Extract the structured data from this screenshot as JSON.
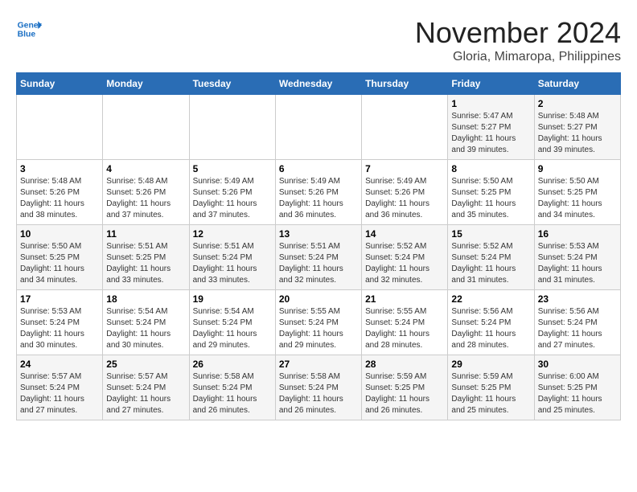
{
  "logo": {
    "line1": "General",
    "line2": "Blue"
  },
  "title": "November 2024",
  "location": "Gloria, Mimaropa, Philippines",
  "days_of_week": [
    "Sunday",
    "Monday",
    "Tuesday",
    "Wednesday",
    "Thursday",
    "Friday",
    "Saturday"
  ],
  "weeks": [
    [
      {
        "day": "",
        "info": ""
      },
      {
        "day": "",
        "info": ""
      },
      {
        "day": "",
        "info": ""
      },
      {
        "day": "",
        "info": ""
      },
      {
        "day": "",
        "info": ""
      },
      {
        "day": "1",
        "info": "Sunrise: 5:47 AM\nSunset: 5:27 PM\nDaylight: 11 hours and 39 minutes."
      },
      {
        "day": "2",
        "info": "Sunrise: 5:48 AM\nSunset: 5:27 PM\nDaylight: 11 hours and 39 minutes."
      }
    ],
    [
      {
        "day": "3",
        "info": "Sunrise: 5:48 AM\nSunset: 5:26 PM\nDaylight: 11 hours and 38 minutes."
      },
      {
        "day": "4",
        "info": "Sunrise: 5:48 AM\nSunset: 5:26 PM\nDaylight: 11 hours and 37 minutes."
      },
      {
        "day": "5",
        "info": "Sunrise: 5:49 AM\nSunset: 5:26 PM\nDaylight: 11 hours and 37 minutes."
      },
      {
        "day": "6",
        "info": "Sunrise: 5:49 AM\nSunset: 5:26 PM\nDaylight: 11 hours and 36 minutes."
      },
      {
        "day": "7",
        "info": "Sunrise: 5:49 AM\nSunset: 5:26 PM\nDaylight: 11 hours and 36 minutes."
      },
      {
        "day": "8",
        "info": "Sunrise: 5:50 AM\nSunset: 5:25 PM\nDaylight: 11 hours and 35 minutes."
      },
      {
        "day": "9",
        "info": "Sunrise: 5:50 AM\nSunset: 5:25 PM\nDaylight: 11 hours and 34 minutes."
      }
    ],
    [
      {
        "day": "10",
        "info": "Sunrise: 5:50 AM\nSunset: 5:25 PM\nDaylight: 11 hours and 34 minutes."
      },
      {
        "day": "11",
        "info": "Sunrise: 5:51 AM\nSunset: 5:25 PM\nDaylight: 11 hours and 33 minutes."
      },
      {
        "day": "12",
        "info": "Sunrise: 5:51 AM\nSunset: 5:24 PM\nDaylight: 11 hours and 33 minutes."
      },
      {
        "day": "13",
        "info": "Sunrise: 5:51 AM\nSunset: 5:24 PM\nDaylight: 11 hours and 32 minutes."
      },
      {
        "day": "14",
        "info": "Sunrise: 5:52 AM\nSunset: 5:24 PM\nDaylight: 11 hours and 32 minutes."
      },
      {
        "day": "15",
        "info": "Sunrise: 5:52 AM\nSunset: 5:24 PM\nDaylight: 11 hours and 31 minutes."
      },
      {
        "day": "16",
        "info": "Sunrise: 5:53 AM\nSunset: 5:24 PM\nDaylight: 11 hours and 31 minutes."
      }
    ],
    [
      {
        "day": "17",
        "info": "Sunrise: 5:53 AM\nSunset: 5:24 PM\nDaylight: 11 hours and 30 minutes."
      },
      {
        "day": "18",
        "info": "Sunrise: 5:54 AM\nSunset: 5:24 PM\nDaylight: 11 hours and 30 minutes."
      },
      {
        "day": "19",
        "info": "Sunrise: 5:54 AM\nSunset: 5:24 PM\nDaylight: 11 hours and 29 minutes."
      },
      {
        "day": "20",
        "info": "Sunrise: 5:55 AM\nSunset: 5:24 PM\nDaylight: 11 hours and 29 minutes."
      },
      {
        "day": "21",
        "info": "Sunrise: 5:55 AM\nSunset: 5:24 PM\nDaylight: 11 hours and 28 minutes."
      },
      {
        "day": "22",
        "info": "Sunrise: 5:56 AM\nSunset: 5:24 PM\nDaylight: 11 hours and 28 minutes."
      },
      {
        "day": "23",
        "info": "Sunrise: 5:56 AM\nSunset: 5:24 PM\nDaylight: 11 hours and 27 minutes."
      }
    ],
    [
      {
        "day": "24",
        "info": "Sunrise: 5:57 AM\nSunset: 5:24 PM\nDaylight: 11 hours and 27 minutes."
      },
      {
        "day": "25",
        "info": "Sunrise: 5:57 AM\nSunset: 5:24 PM\nDaylight: 11 hours and 27 minutes."
      },
      {
        "day": "26",
        "info": "Sunrise: 5:58 AM\nSunset: 5:24 PM\nDaylight: 11 hours and 26 minutes."
      },
      {
        "day": "27",
        "info": "Sunrise: 5:58 AM\nSunset: 5:24 PM\nDaylight: 11 hours and 26 minutes."
      },
      {
        "day": "28",
        "info": "Sunrise: 5:59 AM\nSunset: 5:25 PM\nDaylight: 11 hours and 26 minutes."
      },
      {
        "day": "29",
        "info": "Sunrise: 5:59 AM\nSunset: 5:25 PM\nDaylight: 11 hours and 25 minutes."
      },
      {
        "day": "30",
        "info": "Sunrise: 6:00 AM\nSunset: 5:25 PM\nDaylight: 11 hours and 25 minutes."
      }
    ]
  ]
}
